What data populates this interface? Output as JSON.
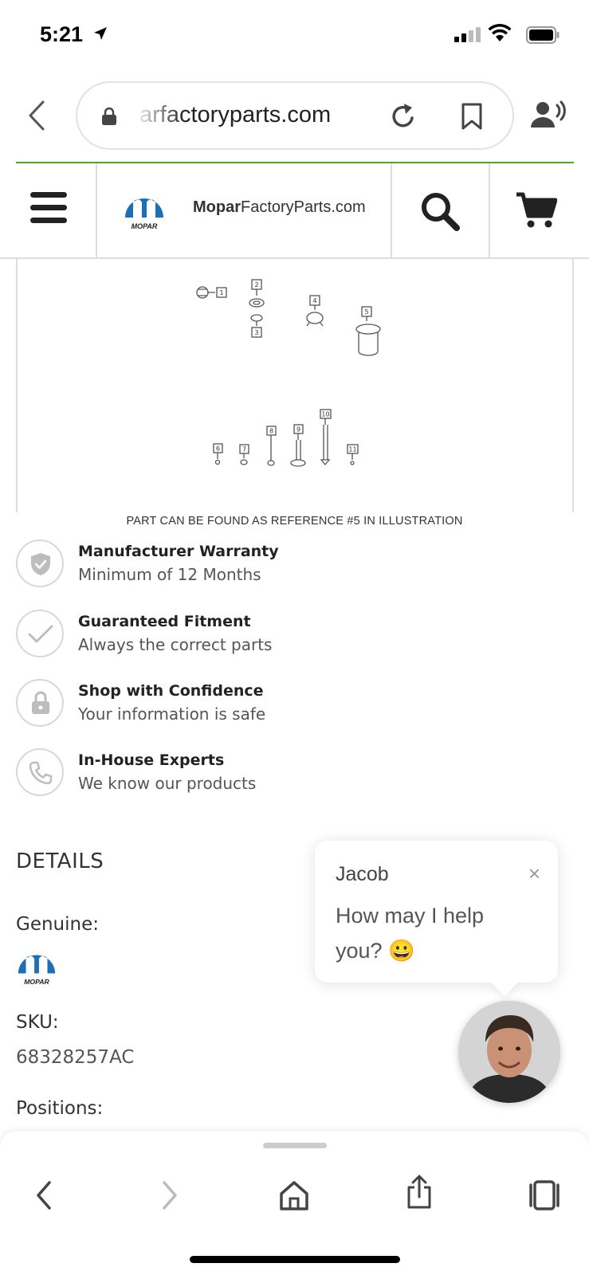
{
  "status_bar": {
    "time": "5:21"
  },
  "browser": {
    "url": "mparfactoryparts.com",
    "url_visible": "arfactoryparts.com"
  },
  "site": {
    "name_bold": "Mopar",
    "name_rest": "FactoryParts.com",
    "logo_text": "MOPAR"
  },
  "diagram": {
    "caption": "PART CAN BE FOUND AS REFERENCE #5 IN ILLUSTRATION",
    "callouts": [
      "1",
      "2",
      "3",
      "4",
      "5",
      "6",
      "7",
      "8",
      "9",
      "10",
      "11"
    ]
  },
  "features": [
    {
      "title": "Manufacturer Warranty",
      "subtitle": "Minimum of 12 Months",
      "icon": "shield-check-icon"
    },
    {
      "title": "Guaranteed Fitment",
      "subtitle": "Always the correct parts",
      "icon": "checkmark-icon"
    },
    {
      "title": "Shop with Confidence",
      "subtitle": "Your information is safe",
      "icon": "padlock-icon"
    },
    {
      "title": "In-House Experts",
      "subtitle": "We know our products",
      "icon": "phone-icon"
    }
  ],
  "details": {
    "heading": "DETAILS",
    "genuine_label": "Genuine:",
    "sku_label": "SKU:",
    "sku_value": "68328257AC",
    "positions_label": "Positions:"
  },
  "chat": {
    "agent_name": "Jacob",
    "message": "How may I help you?",
    "emoji": "😀",
    "close": "×"
  },
  "colors": {
    "mopar_blue": "#1f6fb6",
    "accent_green": "#5a9a3c",
    "icon_dark": "#222222"
  }
}
